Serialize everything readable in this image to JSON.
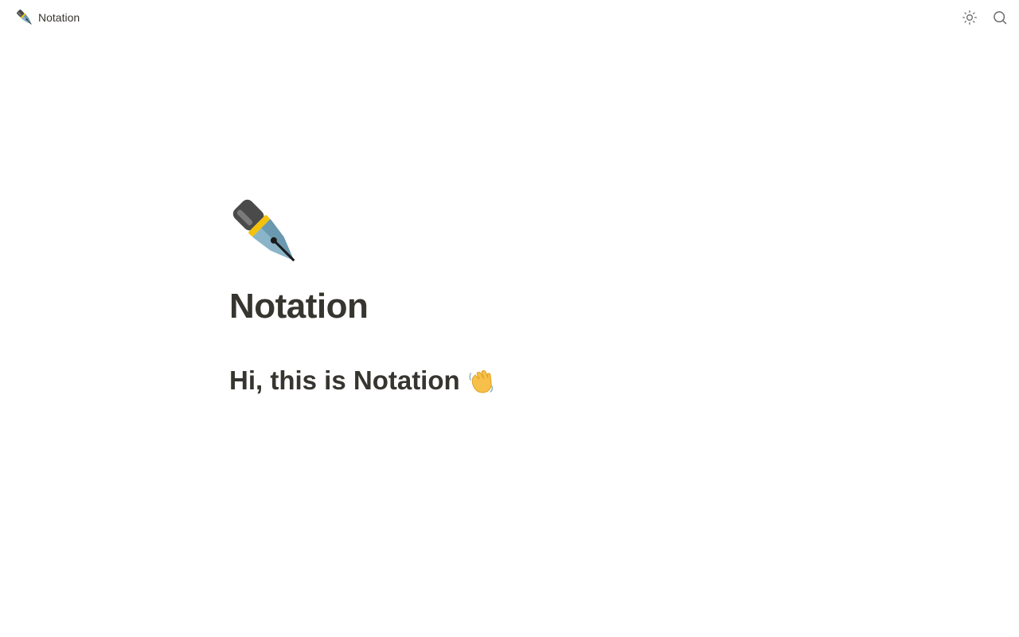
{
  "topbar": {
    "brand_label": "Notation",
    "brand_icon": "fountain-pen-icon",
    "theme_toggle_icon": "sun-icon",
    "search_icon": "search-icon"
  },
  "page": {
    "icon": "fountain-pen-icon",
    "title": "Notation",
    "heading": "Hi, this is Notation",
    "heading_emoji": "waving-hand-icon"
  },
  "colors": {
    "text": "#37352f",
    "icon": "#6b6b6b",
    "background": "#ffffff"
  }
}
